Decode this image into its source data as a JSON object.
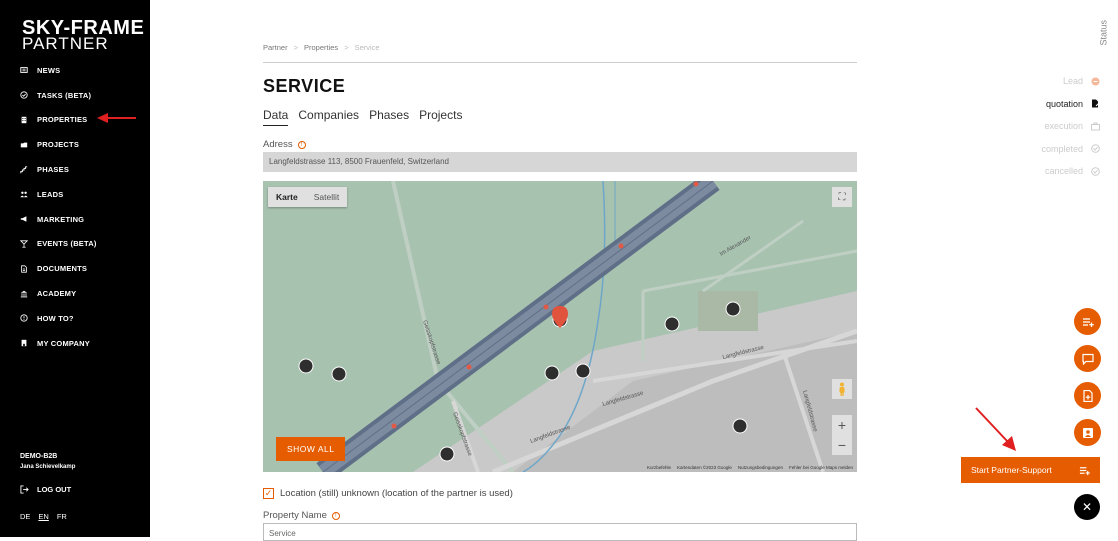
{
  "brand": {
    "line1": "SKY-FRAME",
    "line2": "PARTNER"
  },
  "nav": [
    {
      "label": "NEWS",
      "icon": "newspaper-icon"
    },
    {
      "label": "TASKS (BETA)",
      "icon": "check-circle-icon"
    },
    {
      "label": "PROPERTIES",
      "icon": "building-icon"
    },
    {
      "label": "PROJECTS",
      "icon": "folder-icon"
    },
    {
      "label": "PHASES",
      "icon": "stairs-icon"
    },
    {
      "label": "LEADS",
      "icon": "people-icon"
    },
    {
      "label": "MARKETING",
      "icon": "megaphone-icon"
    },
    {
      "label": "EVENTS (BETA)",
      "icon": "cocktail-icon"
    },
    {
      "label": "DOCUMENTS",
      "icon": "document-icon"
    },
    {
      "label": "ACADEMY",
      "icon": "academy-icon"
    },
    {
      "label": "HOW TO?",
      "icon": "help-circle-icon"
    },
    {
      "label": "MY COMPANY",
      "icon": "company-icon"
    }
  ],
  "account": {
    "company": "DEMO-B2B",
    "user": "Jana Schievelkamp"
  },
  "logout_label": "LOG OUT",
  "languages": [
    "DE",
    "EN",
    "FR"
  ],
  "active_language": "EN",
  "breadcrumb": {
    "items": [
      "Partner",
      "Properties",
      "Service"
    ],
    "separator": ">"
  },
  "page_title": "SERVICE",
  "tabs": [
    "Data",
    "Companies",
    "Phases",
    "Projects"
  ],
  "active_tab": "Data",
  "address": {
    "label": "Adress",
    "value": "Langfeldstrasse 113, 8500 Frauenfeld, Switzerland"
  },
  "map": {
    "type_buttons": [
      "Karte",
      "Satellit"
    ],
    "active_type": "Karte",
    "show_all_label": "SHOW ALL",
    "street_labels": [
      "Im Alexander",
      "Langfeldstrasse",
      "Langfeldstrasse",
      "Langfeldstrasse",
      "Langfeldstrasse",
      "Geisskopfstrasse",
      "Geisskopfstrasse"
    ],
    "attribution": [
      "Kurzbefehle",
      "Kartendaten ©2023 Google",
      "Nutzungsbedingungen",
      "Fehler bei Google Maps melden"
    ],
    "zoom_in": "+",
    "zoom_out": "−"
  },
  "location_checkbox": {
    "label": "Location (still) unknown (location of the partner is used)",
    "checked": true
  },
  "property_name": {
    "label": "Property Name",
    "value": "Service"
  },
  "status_panel": {
    "title": "Status",
    "items": [
      {
        "label": "Lead",
        "icon": "dot-icon",
        "active": false
      },
      {
        "label": "quotation",
        "icon": "document-edit-icon",
        "active": true
      },
      {
        "label": "execution",
        "icon": "briefcase-icon",
        "active": false
      },
      {
        "label": "completed",
        "icon": "check-circle-icon",
        "active": false
      },
      {
        "label": "cancelled",
        "icon": "check-circle-icon",
        "active": false
      }
    ]
  },
  "support_label": "Start Partner-Support",
  "colors": {
    "accent": "#e65c00",
    "sidebar": "#000000",
    "arrow": "#e02020"
  }
}
